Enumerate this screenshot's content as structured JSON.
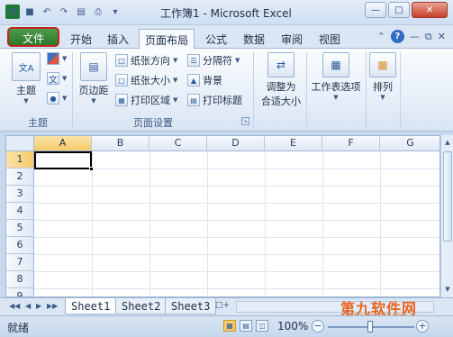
{
  "window": {
    "title": "工作簿1 - Microsoft Excel",
    "app_icon": "X"
  },
  "quick_access": {
    "icons": [
      "save-icon",
      "undo-icon",
      "redo-icon",
      "print-preview-icon",
      "print-icon",
      "customize-icon"
    ]
  },
  "tabs": [
    {
      "label": "文件",
      "highlighted": true
    },
    {
      "label": "开始"
    },
    {
      "label": "插入"
    },
    {
      "label": "页面布局",
      "active": true
    },
    {
      "label": "公式"
    },
    {
      "label": "数据"
    },
    {
      "label": "审阅"
    },
    {
      "label": "视图"
    }
  ],
  "ribbon": {
    "themes": {
      "theme_label": "主题",
      "group_label": "主题",
      "small_labels": [
        "文"
      ]
    },
    "page_setup": {
      "margins_label": "页边距",
      "orientation_label": "纸张方向",
      "size_label": "纸张大小",
      "print_area_label": "打印区域",
      "breaks_label": "分隔符",
      "background_label": "背景",
      "print_titles_label": "打印标题",
      "group_label": "页面设置"
    },
    "scale": {
      "fit_label_1": "调整为",
      "fit_label_2": "合适大小"
    },
    "sheet_options": {
      "label": "工作表选项"
    },
    "arrange": {
      "label": "排列"
    }
  },
  "grid": {
    "columns": [
      "A",
      "B",
      "C",
      "D",
      "E",
      "F",
      "G"
    ],
    "rows": [
      "1",
      "2",
      "3",
      "4",
      "5",
      "6",
      "7",
      "8",
      "9"
    ],
    "selected_cell": "A1"
  },
  "sheets": [
    "Sheet1",
    "Sheet2",
    "Sheet3"
  ],
  "active_sheet": "Sheet1",
  "status": {
    "ready": "就绪",
    "zoom": "100%"
  },
  "watermark": {
    "text": "第九软件网",
    "sub": "WWW.D9SOFT.COM"
  },
  "colors": {
    "file_tab": "#2a7a2a",
    "file_tab_outline": "#c0271d",
    "selected_header": "#f6cb6a"
  }
}
